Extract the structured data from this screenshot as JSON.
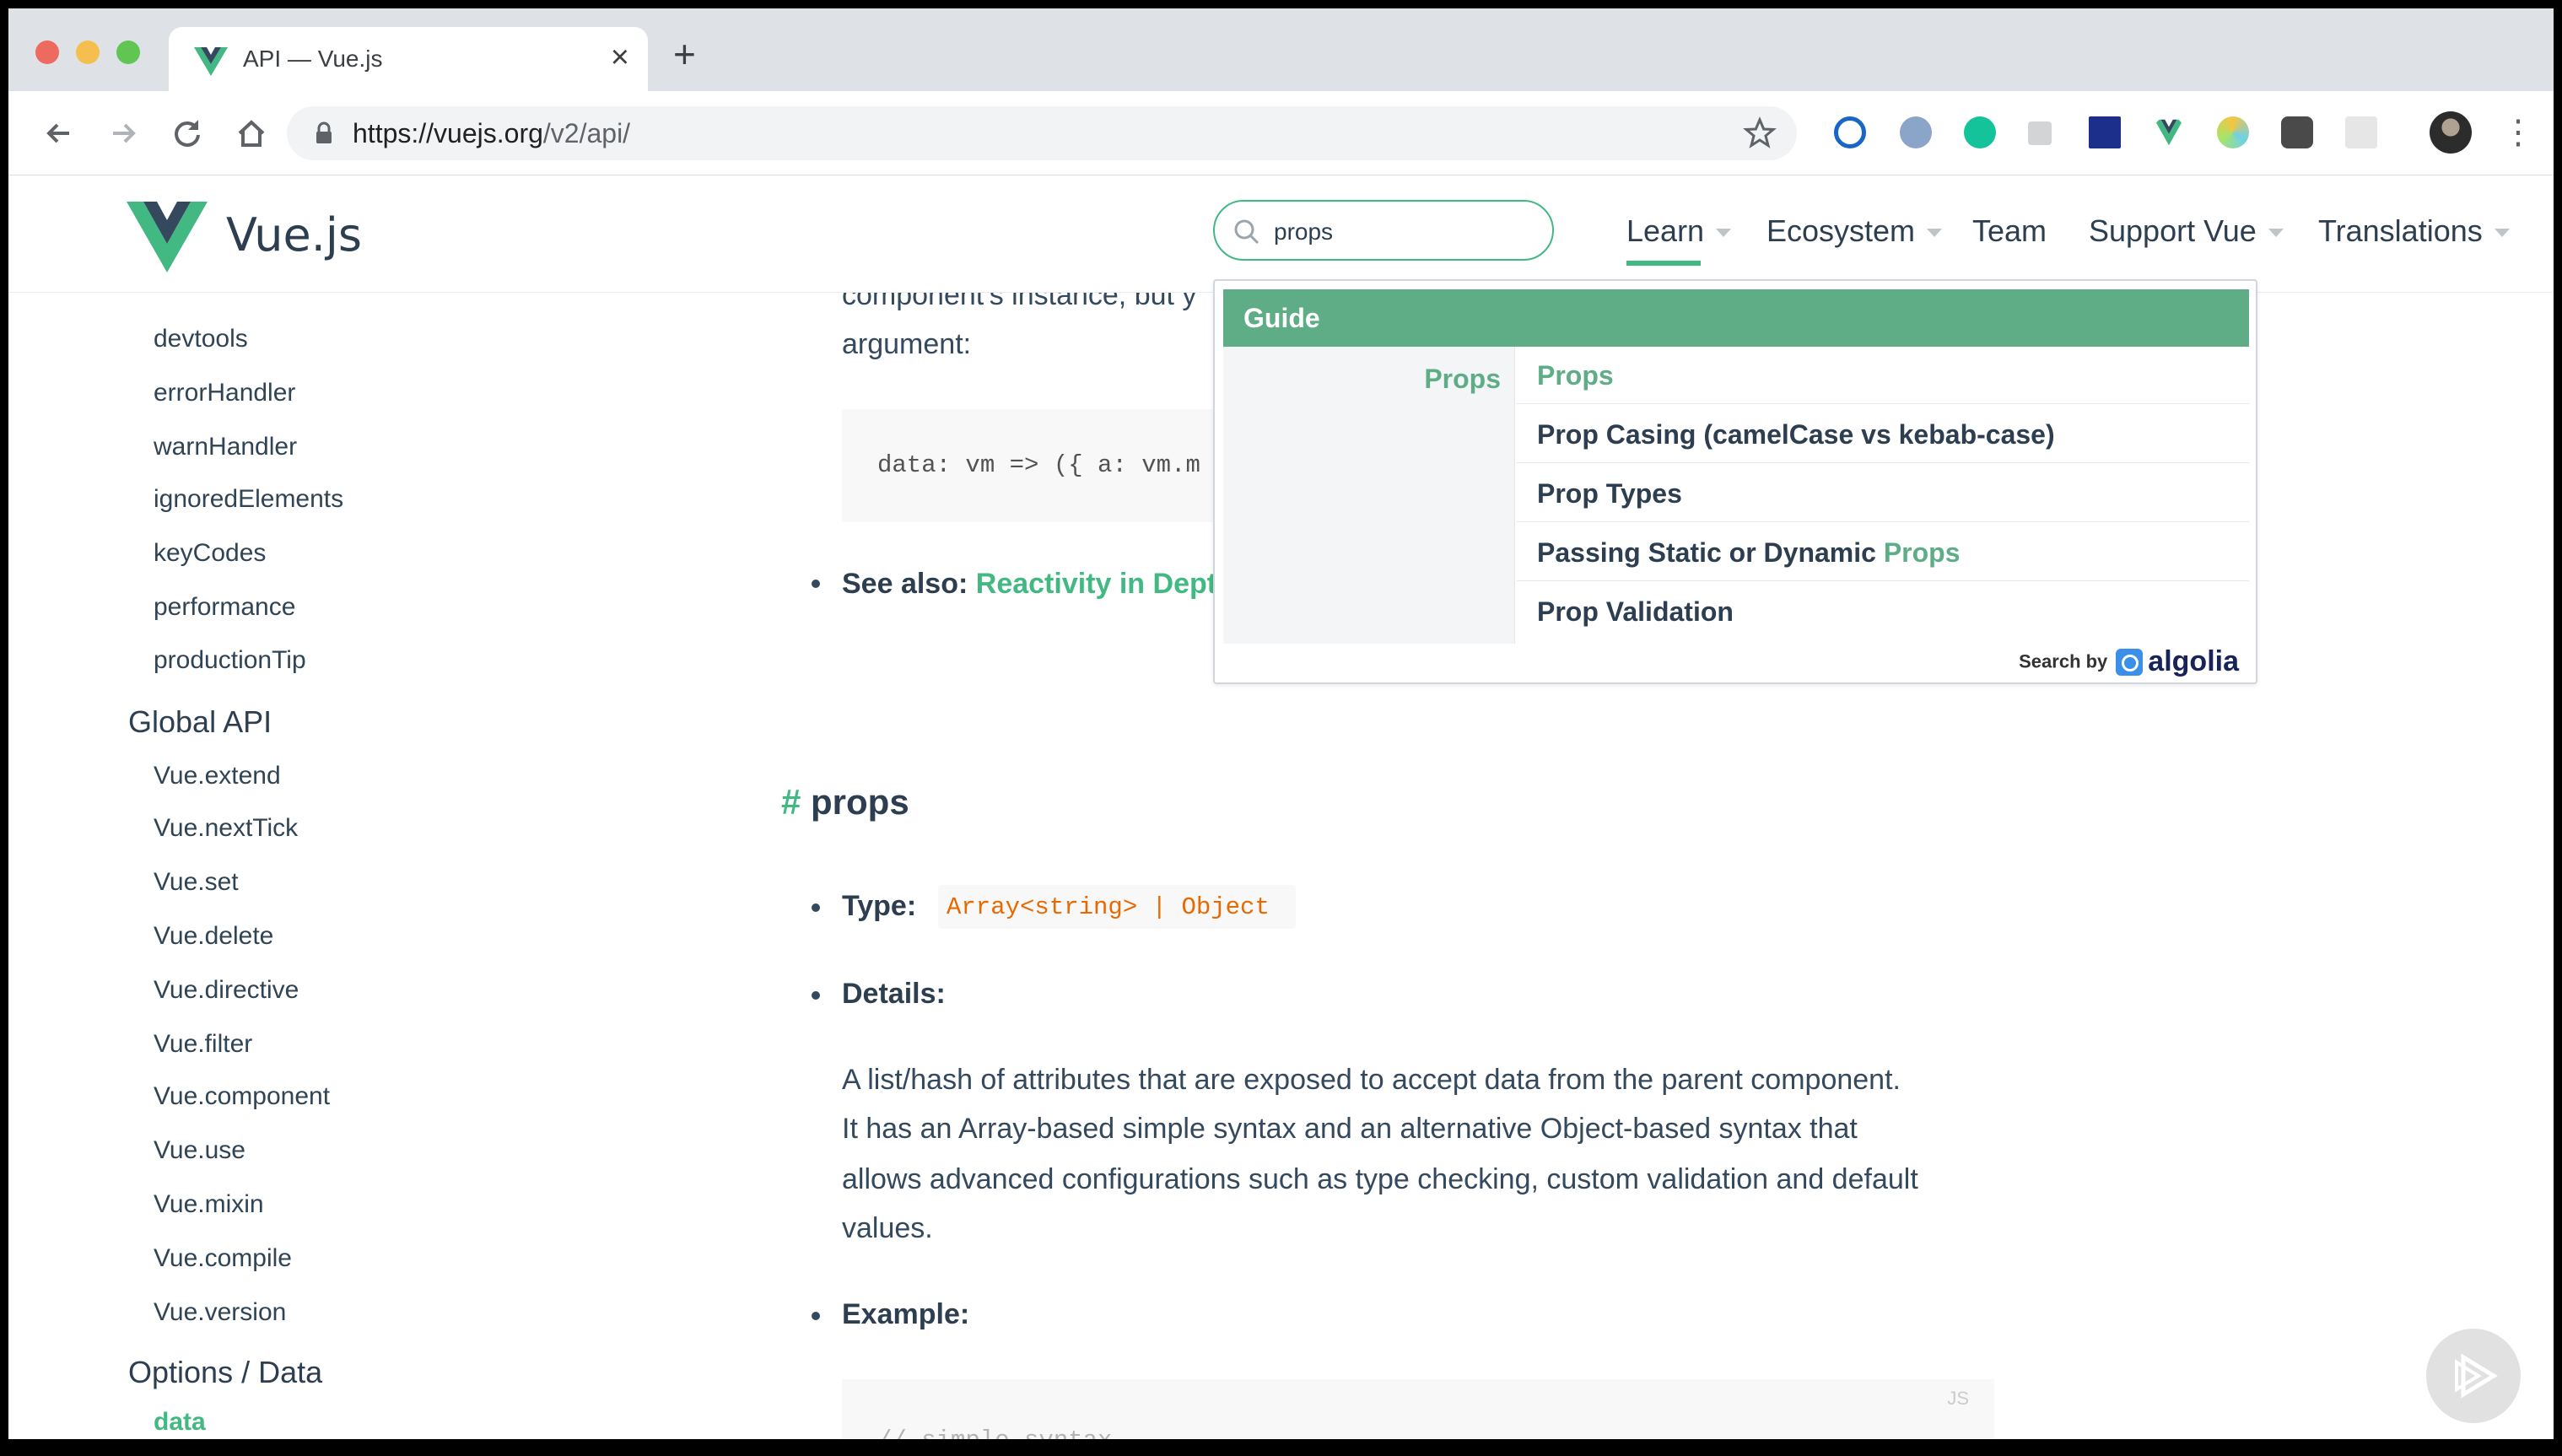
{
  "browser": {
    "tab_title": "API — Vue.js",
    "url_host": "https://vuejs.org",
    "url_path": "/v2/api/",
    "close_glyph": "×",
    "new_tab_glyph": "+",
    "menu_glyph": "⋮",
    "extensions": [
      "1password-icon",
      "puzzle-ext-icon",
      "grammarly-icon",
      "gray-ext-icon",
      "dark-blue-ext-icon",
      "vue-devtools-icon",
      "colorful-ext-icon",
      "settings-ext-icon",
      "light-ext-icon"
    ]
  },
  "site": {
    "logo_text": "Vue.js",
    "search_value": "props",
    "nav": {
      "learn": "Learn",
      "ecosystem": "Ecosystem",
      "team": "Team",
      "support": "Support Vue",
      "translations": "Translations"
    },
    "accent": "#42b983"
  },
  "sidebar": {
    "config_items": [
      "devtools",
      "errorHandler",
      "warnHandler",
      "ignoredElements",
      "keyCodes",
      "performance",
      "productionTip"
    ],
    "global_api_heading": "Global API",
    "global_api_items": [
      "Vue.extend",
      "Vue.nextTick",
      "Vue.set",
      "Vue.delete",
      "Vue.directive",
      "Vue.filter",
      "Vue.component",
      "Vue.use",
      "Vue.mixin",
      "Vue.compile",
      "Vue.version"
    ],
    "options_heading": "Options / Data",
    "options_items": [
      "data"
    ]
  },
  "content": {
    "line1": "component's instance, but y",
    "line2": "argument:",
    "code_snippet": "data: vm => ({ a: vm.m",
    "see_also_label": "See also:",
    "see_also_link": "Reactivity in Dept",
    "props_hash": "#",
    "props_heading": "props",
    "type_label": "Type:",
    "type_value": "Array<string> | Object",
    "details_label": "Details:",
    "details_lines": [
      "A list/hash of attributes that are exposed to accept data from the parent component.",
      "It has an Array-based simple syntax and an alternative Object-based syntax that",
      "allows advanced configurations such as type checking, custom validation and default",
      "values."
    ],
    "example_label": "Example:",
    "example_code_comment": "// simple syntax",
    "code_lang": "JS"
  },
  "search_dropdown": {
    "category": "Guide",
    "subcategory": "Props",
    "results": [
      {
        "pre": "",
        "hl": "Props",
        "post": ""
      },
      {
        "pre": "Prop Casing (camelCase vs kebab-case)",
        "hl": "",
        "post": ""
      },
      {
        "pre": "Prop Types",
        "hl": "",
        "post": ""
      },
      {
        "pre": "Passing Static or Dynamic ",
        "hl": "Props",
        "post": ""
      },
      {
        "pre": "Prop Validation",
        "hl": "",
        "post": ""
      }
    ],
    "footer_label": "Search by",
    "footer_brand": "algolia"
  }
}
